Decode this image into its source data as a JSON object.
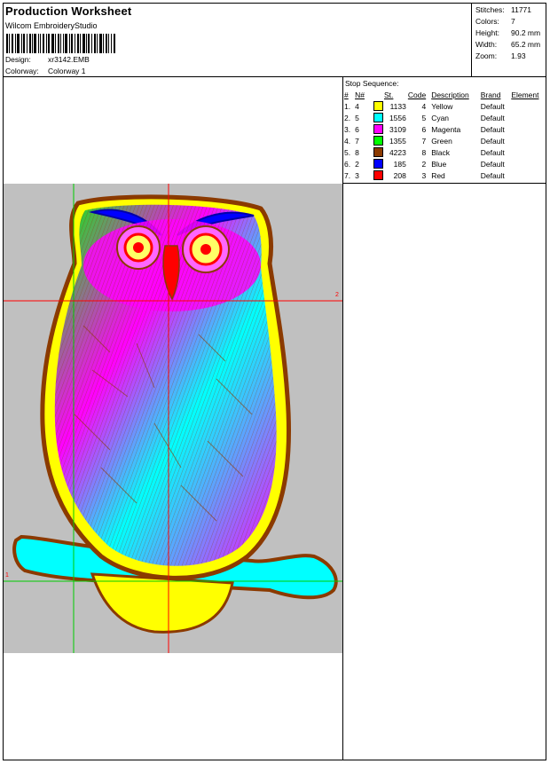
{
  "header": {
    "title": "Production Worksheet",
    "software": "Wilcom  EmbroideryStudio",
    "design_label": "Design:",
    "design_value": "xr3142.EMB",
    "colorway_label": "Colorway:",
    "colorway_value": "Colorway 1"
  },
  "stats": {
    "stitches_label": "Stitches:",
    "stitches_value": "11771",
    "colors_label": "Colors:",
    "colors_value": "7",
    "height_label": "Height:",
    "height_value": "90.2 mm",
    "width_label": "Width:",
    "width_value": "65.2 mm",
    "zoom_label": "Zoom:",
    "zoom_value": "1.93"
  },
  "stop_sequence": {
    "title": "Stop Sequence:",
    "headers": {
      "num": "#",
      "n": "N#",
      "st": "St.",
      "code": "Code",
      "description": "Description",
      "brand": "Brand",
      "element": "Element"
    },
    "rows": [
      {
        "num": "1.",
        "n": "4",
        "color": "#ffff00",
        "st": "1133",
        "code": "4",
        "description": "Yellow",
        "brand": "Default"
      },
      {
        "num": "2.",
        "n": "5",
        "color": "#00ffff",
        "st": "1556",
        "code": "5",
        "description": "Cyan",
        "brand": "Default"
      },
      {
        "num": "3.",
        "n": "6",
        "color": "#ff00ff",
        "st": "3109",
        "code": "6",
        "description": "Magenta",
        "brand": "Default"
      },
      {
        "num": "4.",
        "n": "7",
        "color": "#00ff00",
        "st": "1355",
        "code": "7",
        "description": "Green",
        "brand": "Default"
      },
      {
        "num": "5.",
        "n": "8",
        "color": "#8b3a00",
        "st": "4223",
        "code": "8",
        "description": "Black",
        "brand": "Default"
      },
      {
        "num": "6.",
        "n": "2",
        "color": "#0000ff",
        "st": "185",
        "code": "2",
        "description": "Blue",
        "brand": "Default"
      },
      {
        "num": "7.",
        "n": "3",
        "color": "#ff0000",
        "st": "208",
        "code": "3",
        "description": "Red",
        "brand": "Default"
      }
    ]
  },
  "canvas": {
    "background": "#c0c0c0",
    "axis_label_right": "2",
    "axis_label_left": "1"
  }
}
